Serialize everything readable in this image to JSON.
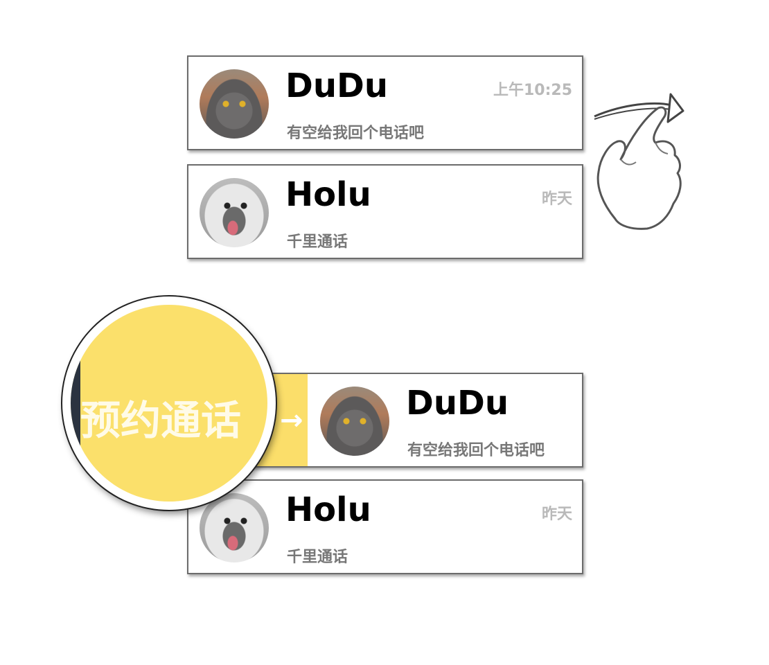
{
  "top_list": [
    {
      "name": "DuDu",
      "message": "有空给我回个电话吧",
      "time": "上午10:25",
      "avatar": "cat-avatar"
    },
    {
      "name": "Holu",
      "message": "千里通话",
      "time": "昨天",
      "avatar": "dog-avatar"
    }
  ],
  "bottom_list": [
    {
      "name": "DuDu",
      "message": "有空给我回个电话吧",
      "avatar": "cat-avatar",
      "action": "预约通话"
    },
    {
      "name": "Holu",
      "message": "千里通话",
      "time": "昨天",
      "avatar": "dog-avatar"
    }
  ],
  "magnifier": {
    "label": "预约通话"
  },
  "icons": {
    "gesture": "swipe-right-hand-icon",
    "arrow": "arrow-right-icon"
  },
  "colors": {
    "accent": "#fbde6a",
    "border": "#6b6b6b",
    "time_text": "#b9b9b9",
    "message_text": "#777777"
  }
}
